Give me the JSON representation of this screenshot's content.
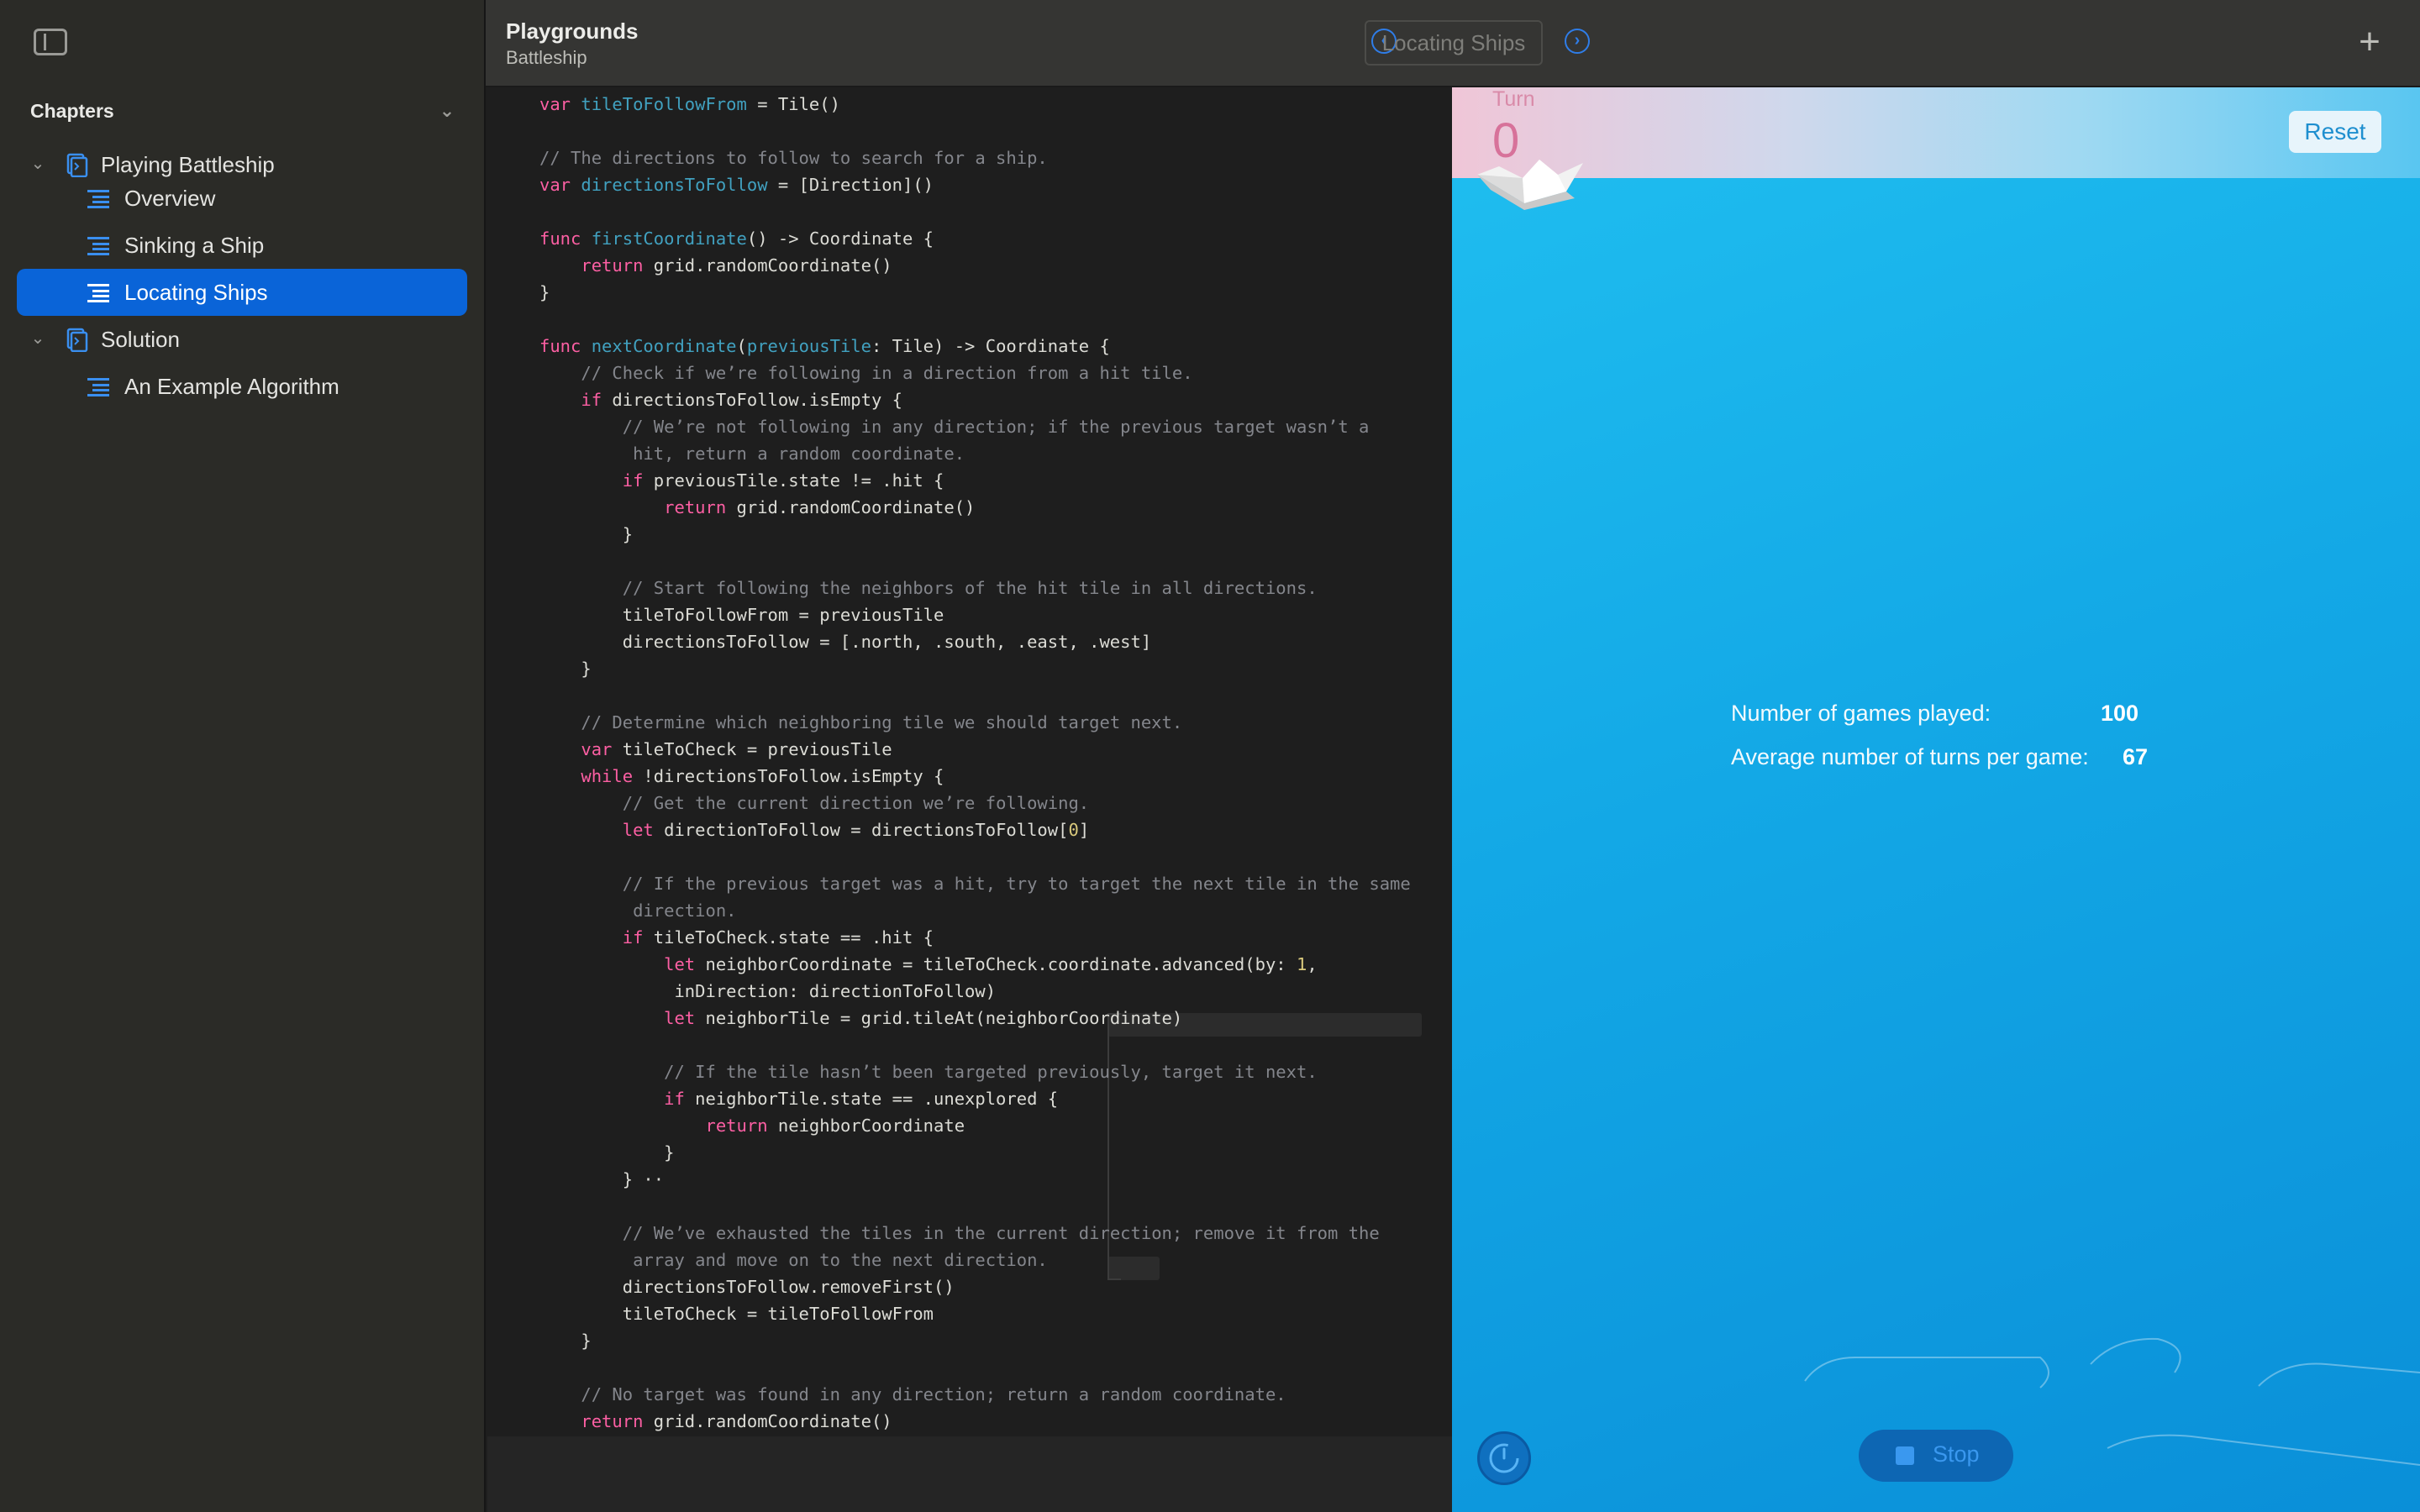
{
  "sidebar": {
    "header": "Chapters",
    "items": [
      {
        "label": "Playing Battleship",
        "type": "chapter"
      },
      {
        "label": "Overview",
        "type": "page"
      },
      {
        "label": "Sinking a Ship",
        "type": "page"
      },
      {
        "label": "Locating Ships",
        "type": "page",
        "selected": true
      },
      {
        "label": "Solution",
        "type": "chapter"
      },
      {
        "label": "An Example Algorithm",
        "type": "page"
      }
    ]
  },
  "topbar": {
    "title": "Playgrounds",
    "subtitle": "Battleship",
    "current_page": "Locating Ships",
    "add_symbol": "+"
  },
  "editor": {
    "lines": [
      [
        [
          "kw",
          "var "
        ],
        [
          "fn",
          "tileToFollowFrom"
        ],
        [
          "t",
          " = Tile()"
        ]
      ],
      [],
      [
        [
          "cm",
          "// The directions to follow to search for a ship."
        ]
      ],
      [
        [
          "kw",
          "var "
        ],
        [
          "fn",
          "directionsToFollow"
        ],
        [
          "t",
          " = [Direction]()"
        ]
      ],
      [],
      [
        [
          "kw",
          "func "
        ],
        [
          "fn",
          "firstCoordinate"
        ],
        [
          "t",
          "() -> Coordinate {"
        ]
      ],
      [
        [
          "t",
          "    "
        ],
        [
          "kw",
          "return"
        ],
        [
          "t",
          " grid.randomCoordinate()"
        ]
      ],
      [
        [
          "t",
          "}"
        ]
      ],
      [],
      [
        [
          "kw",
          "func "
        ],
        [
          "fn",
          "nextCoordinate"
        ],
        [
          "t",
          "("
        ],
        [
          "fn",
          "previousTile"
        ],
        [
          "t",
          ": Tile) -> Coordinate {"
        ]
      ],
      [
        [
          "t",
          "    "
        ],
        [
          "cm",
          "// Check if we’re following in a direction from a hit tile."
        ]
      ],
      [
        [
          "t",
          "    "
        ],
        [
          "kw",
          "if"
        ],
        [
          "t",
          " directionsToFollow.isEmpty {"
        ]
      ],
      [
        [
          "t",
          "        "
        ],
        [
          "cm",
          "// We’re not following in any direction; if the previous target wasn’t a"
        ]
      ],
      [
        [
          "t",
          "         "
        ],
        [
          "cm",
          "hit, return a random coordinate."
        ]
      ],
      [
        [
          "t",
          "        "
        ],
        [
          "kw",
          "if"
        ],
        [
          "t",
          " previousTile.state != .hit {"
        ]
      ],
      [
        [
          "t",
          "            "
        ],
        [
          "kw",
          "return"
        ],
        [
          "t",
          " grid.randomCoordinate()"
        ]
      ],
      [
        [
          "t",
          "        }"
        ]
      ],
      [],
      [
        [
          "t",
          "        "
        ],
        [
          "cm",
          "// Start following the neighbors of the hit tile in all directions."
        ]
      ],
      [
        [
          "t",
          "        tileToFollowFrom = previousTile"
        ]
      ],
      [
        [
          "t",
          "        directionsToFollow = [.north, .south, .east, .west]"
        ]
      ],
      [
        [
          "t",
          "    }"
        ]
      ],
      [],
      [
        [
          "t",
          "    "
        ],
        [
          "cm",
          "// Determine which neighboring tile we should target next."
        ]
      ],
      [
        [
          "t",
          "    "
        ],
        [
          "kw",
          "var"
        ],
        [
          "t",
          " tileToCheck = previousTile"
        ]
      ],
      [
        [
          "t",
          "    "
        ],
        [
          "kw",
          "while"
        ],
        [
          "t",
          " !directionsToFollow.isEmpty {"
        ]
      ],
      [
        [
          "t",
          "        "
        ],
        [
          "cm",
          "// Get the current direction we’re following."
        ]
      ],
      [
        [
          "t",
          "        "
        ],
        [
          "kw",
          "let"
        ],
        [
          "t",
          " directionToFollow = directionsToFollow["
        ],
        [
          "nm",
          "0"
        ],
        [
          "t",
          "]"
        ]
      ],
      [],
      [
        [
          "t",
          "        "
        ],
        [
          "cm",
          "// If the previous target was a hit, try to target the next tile in the same"
        ]
      ],
      [
        [
          "t",
          "         "
        ],
        [
          "cm",
          "direction."
        ]
      ],
      [
        [
          "t",
          "        "
        ],
        [
          "kw",
          "if"
        ],
        [
          "t",
          " tileToCheck.state == .hit {"
        ]
      ],
      [
        [
          "t",
          "            "
        ],
        [
          "kw",
          "let"
        ],
        [
          "t",
          " neighborCoordinate = tileToCheck.coordinate.advanced(by: "
        ],
        [
          "nm",
          "1"
        ],
        [
          "t",
          ","
        ]
      ],
      [
        [
          "t",
          "             inDirection: directionToFollow)"
        ]
      ],
      [
        [
          "t",
          "            "
        ],
        [
          "kw",
          "let"
        ],
        [
          "t",
          " neighborTile = grid.tileAt(neighborCoordinate)"
        ]
      ],
      [],
      [
        [
          "t",
          "            "
        ],
        [
          "cm",
          "// If the tile hasn’t been targeted previously, target it next."
        ]
      ],
      [
        [
          "t",
          "            "
        ],
        [
          "kw",
          "if"
        ],
        [
          "t",
          " neighborTile.state == .unexplored {"
        ]
      ],
      [
        [
          "t",
          "                "
        ],
        [
          "kw",
          "return"
        ],
        [
          "t",
          " neighborCoordinate"
        ]
      ],
      [
        [
          "t",
          "            }"
        ]
      ],
      [
        [
          "t",
          "        } ··"
        ]
      ],
      [],
      [
        [
          "t",
          "        "
        ],
        [
          "cm",
          "// We’ve exhausted the tiles in the current direction; remove it from the"
        ]
      ],
      [
        [
          "t",
          "         "
        ],
        [
          "cm",
          "array and move on to the next direction."
        ]
      ],
      [
        [
          "t",
          "        directionsToFollow.removeFirst()"
        ]
      ],
      [
        [
          "t",
          "        tileToCheck = tileToFollowFrom"
        ]
      ],
      [
        [
          "t",
          "    }"
        ]
      ],
      [],
      [
        [
          "t",
          "    "
        ],
        [
          "cm",
          "// No target was found in any direction; return a random coordinate."
        ]
      ],
      [
        [
          "t",
          "    "
        ],
        [
          "kw",
          "return"
        ],
        [
          "t",
          " grid.randomCoordinate()"
        ]
      ]
    ]
  },
  "liveview": {
    "turn_label": "Turn",
    "turn_value": "0",
    "reset_label": "Reset",
    "stats": [
      {
        "label": "Number of games played:",
        "value": "100"
      },
      {
        "label": "Average number of turns per game:",
        "value": "67"
      }
    ],
    "stop_label": "Stop"
  },
  "colors": {
    "selection": "#0a64d8",
    "keyword": "#fc5fa3",
    "comment": "#84868c",
    "identifier": "#41a1c0",
    "number": "#d9c97c",
    "ocean": "#13a8e6"
  }
}
